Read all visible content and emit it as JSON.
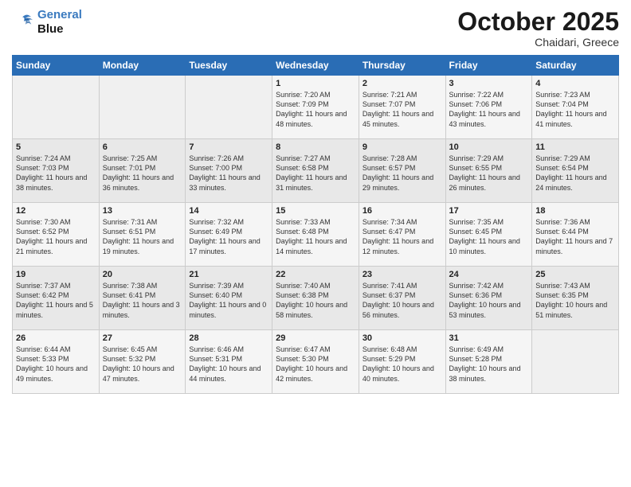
{
  "logo": {
    "line1": "General",
    "line2": "Blue"
  },
  "title": "October 2025",
  "location": "Chaidari, Greece",
  "days_of_week": [
    "Sunday",
    "Monday",
    "Tuesday",
    "Wednesday",
    "Thursday",
    "Friday",
    "Saturday"
  ],
  "weeks": [
    [
      {
        "num": "",
        "info": ""
      },
      {
        "num": "",
        "info": ""
      },
      {
        "num": "",
        "info": ""
      },
      {
        "num": "1",
        "info": "Sunrise: 7:20 AM\nSunset: 7:09 PM\nDaylight: 11 hours and 48 minutes."
      },
      {
        "num": "2",
        "info": "Sunrise: 7:21 AM\nSunset: 7:07 PM\nDaylight: 11 hours and 45 minutes."
      },
      {
        "num": "3",
        "info": "Sunrise: 7:22 AM\nSunset: 7:06 PM\nDaylight: 11 hours and 43 minutes."
      },
      {
        "num": "4",
        "info": "Sunrise: 7:23 AM\nSunset: 7:04 PM\nDaylight: 11 hours and 41 minutes."
      }
    ],
    [
      {
        "num": "5",
        "info": "Sunrise: 7:24 AM\nSunset: 7:03 PM\nDaylight: 11 hours and 38 minutes."
      },
      {
        "num": "6",
        "info": "Sunrise: 7:25 AM\nSunset: 7:01 PM\nDaylight: 11 hours and 36 minutes."
      },
      {
        "num": "7",
        "info": "Sunrise: 7:26 AM\nSunset: 7:00 PM\nDaylight: 11 hours and 33 minutes."
      },
      {
        "num": "8",
        "info": "Sunrise: 7:27 AM\nSunset: 6:58 PM\nDaylight: 11 hours and 31 minutes."
      },
      {
        "num": "9",
        "info": "Sunrise: 7:28 AM\nSunset: 6:57 PM\nDaylight: 11 hours and 29 minutes."
      },
      {
        "num": "10",
        "info": "Sunrise: 7:29 AM\nSunset: 6:55 PM\nDaylight: 11 hours and 26 minutes."
      },
      {
        "num": "11",
        "info": "Sunrise: 7:29 AM\nSunset: 6:54 PM\nDaylight: 11 hours and 24 minutes."
      }
    ],
    [
      {
        "num": "12",
        "info": "Sunrise: 7:30 AM\nSunset: 6:52 PM\nDaylight: 11 hours and 21 minutes."
      },
      {
        "num": "13",
        "info": "Sunrise: 7:31 AM\nSunset: 6:51 PM\nDaylight: 11 hours and 19 minutes."
      },
      {
        "num": "14",
        "info": "Sunrise: 7:32 AM\nSunset: 6:49 PM\nDaylight: 11 hours and 17 minutes."
      },
      {
        "num": "15",
        "info": "Sunrise: 7:33 AM\nSunset: 6:48 PM\nDaylight: 11 hours and 14 minutes."
      },
      {
        "num": "16",
        "info": "Sunrise: 7:34 AM\nSunset: 6:47 PM\nDaylight: 11 hours and 12 minutes."
      },
      {
        "num": "17",
        "info": "Sunrise: 7:35 AM\nSunset: 6:45 PM\nDaylight: 11 hours and 10 minutes."
      },
      {
        "num": "18",
        "info": "Sunrise: 7:36 AM\nSunset: 6:44 PM\nDaylight: 11 hours and 7 minutes."
      }
    ],
    [
      {
        "num": "19",
        "info": "Sunrise: 7:37 AM\nSunset: 6:42 PM\nDaylight: 11 hours and 5 minutes."
      },
      {
        "num": "20",
        "info": "Sunrise: 7:38 AM\nSunset: 6:41 PM\nDaylight: 11 hours and 3 minutes."
      },
      {
        "num": "21",
        "info": "Sunrise: 7:39 AM\nSunset: 6:40 PM\nDaylight: 11 hours and 0 minutes."
      },
      {
        "num": "22",
        "info": "Sunrise: 7:40 AM\nSunset: 6:38 PM\nDaylight: 10 hours and 58 minutes."
      },
      {
        "num": "23",
        "info": "Sunrise: 7:41 AM\nSunset: 6:37 PM\nDaylight: 10 hours and 56 minutes."
      },
      {
        "num": "24",
        "info": "Sunrise: 7:42 AM\nSunset: 6:36 PM\nDaylight: 10 hours and 53 minutes."
      },
      {
        "num": "25",
        "info": "Sunrise: 7:43 AM\nSunset: 6:35 PM\nDaylight: 10 hours and 51 minutes."
      }
    ],
    [
      {
        "num": "26",
        "info": "Sunrise: 6:44 AM\nSunset: 5:33 PM\nDaylight: 10 hours and 49 minutes."
      },
      {
        "num": "27",
        "info": "Sunrise: 6:45 AM\nSunset: 5:32 PM\nDaylight: 10 hours and 47 minutes."
      },
      {
        "num": "28",
        "info": "Sunrise: 6:46 AM\nSunset: 5:31 PM\nDaylight: 10 hours and 44 minutes."
      },
      {
        "num": "29",
        "info": "Sunrise: 6:47 AM\nSunset: 5:30 PM\nDaylight: 10 hours and 42 minutes."
      },
      {
        "num": "30",
        "info": "Sunrise: 6:48 AM\nSunset: 5:29 PM\nDaylight: 10 hours and 40 minutes."
      },
      {
        "num": "31",
        "info": "Sunrise: 6:49 AM\nSunset: 5:28 PM\nDaylight: 10 hours and 38 minutes."
      },
      {
        "num": "",
        "info": ""
      }
    ]
  ]
}
